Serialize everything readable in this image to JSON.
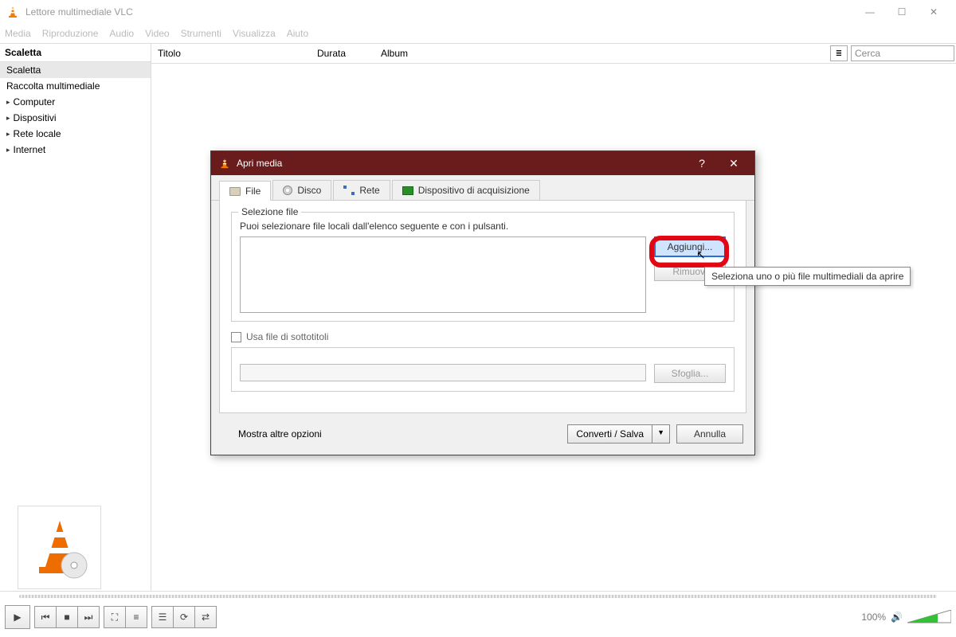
{
  "window": {
    "title": "Lettore multimediale VLC"
  },
  "menu": {
    "items": [
      "Media",
      "Riproduzione",
      "Audio",
      "Video",
      "Strumenti",
      "Visualizza",
      "Aiuto"
    ]
  },
  "sidebar": {
    "header": "Scaletta",
    "search_placeholder": "Cerca",
    "items": [
      {
        "label": "Scaletta",
        "selected": true,
        "expandable": false
      },
      {
        "label": "Raccolta multimediale",
        "selected": false,
        "expandable": false
      },
      {
        "label": "Computer",
        "selected": false,
        "expandable": true
      },
      {
        "label": "Dispositivi",
        "selected": false,
        "expandable": true
      },
      {
        "label": "Rete locale",
        "selected": false,
        "expandable": true
      },
      {
        "label": "Internet",
        "selected": false,
        "expandable": true
      }
    ]
  },
  "columns": {
    "title": "Titolo",
    "duration": "Durata",
    "album": "Album"
  },
  "dialog": {
    "title": "Apri media",
    "tabs": {
      "file": "File",
      "disc": "Disco",
      "net": "Rete",
      "capture": "Dispositivo di acquisizione"
    },
    "file_section": {
      "legend": "Selezione file",
      "instruction": "Puoi selezionare file locali dall'elenco seguente e con i pulsanti.",
      "add": "Aggiungi...",
      "remove": "Rimuovi"
    },
    "subs": {
      "use": "Usa file di sottotitoli",
      "browse": "Sfoglia..."
    },
    "more": "Mostra altre opzioni",
    "convert": "Converti / Salva",
    "cancel": "Annulla",
    "tooltip": "Seleziona uno o più file multimediali da aprire"
  },
  "status": {
    "volume": "100%"
  }
}
